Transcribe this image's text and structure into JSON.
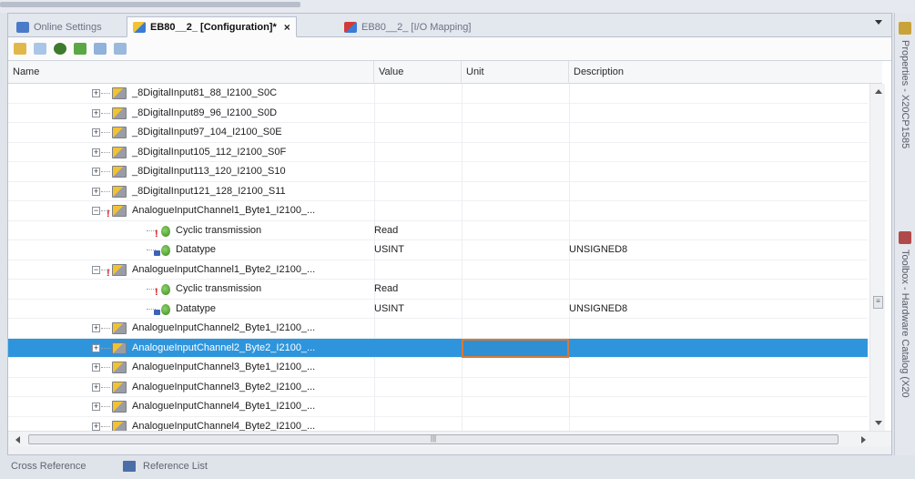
{
  "tabs": [
    {
      "label": "Online Settings",
      "icon": "online-settings-icon",
      "active": false
    },
    {
      "label": "EB80__2_ [Configuration]*",
      "icon": "configuration-icon",
      "active": true
    },
    {
      "label": "EB80__2_ [I/O Mapping]",
      "icon": "io-mapping-icon",
      "active": false
    }
  ],
  "close_symbol": "×",
  "columns": {
    "name": "Name",
    "value": "Value",
    "unit": "Unit",
    "description": "Description"
  },
  "rows": [
    {
      "name": "_8DigitalInput81_88_I2100_S0C",
      "value": "",
      "unit": "",
      "description": ""
    },
    {
      "name": "_8DigitalInput89_96_I2100_S0D",
      "value": "",
      "unit": "",
      "description": ""
    },
    {
      "name": "_8DigitalInput97_104_I2100_S0E",
      "value": "",
      "unit": "",
      "description": ""
    },
    {
      "name": "_8DigitalInput105_112_I2100_S0F",
      "value": "",
      "unit": "",
      "description": ""
    },
    {
      "name": "_8DigitalInput113_120_I2100_S10",
      "value": "",
      "unit": "",
      "description": ""
    },
    {
      "name": "_8DigitalInput121_128_I2100_S11",
      "value": "",
      "unit": "",
      "description": ""
    },
    {
      "name": "AnalogueInputChannel1_Byte1_I2100_...",
      "value": "",
      "unit": "",
      "description": ""
    },
    {
      "name": "Cyclic transmission",
      "value": "Read",
      "unit": "",
      "description": ""
    },
    {
      "name": "Datatype",
      "value": "USINT",
      "unit": "",
      "description": "UNSIGNED8"
    },
    {
      "name": "AnalogueInputChannel1_Byte2_I2100_...",
      "value": "",
      "unit": "",
      "description": ""
    },
    {
      "name": "Cyclic transmission",
      "value": "Read",
      "unit": "",
      "description": ""
    },
    {
      "name": "Datatype",
      "value": "USINT",
      "unit": "",
      "description": "UNSIGNED8"
    },
    {
      "name": "AnalogueInputChannel2_Byte1_I2100_...",
      "value": "",
      "unit": "",
      "description": ""
    },
    {
      "name": "AnalogueInputChannel2_Byte2_I2100_...",
      "value": "",
      "unit": "",
      "description": "",
      "selected": true
    },
    {
      "name": "AnalogueInputChannel3_Byte1_I2100_...",
      "value": "",
      "unit": "",
      "description": ""
    },
    {
      "name": "AnalogueInputChannel3_Byte2_I2100_...",
      "value": "",
      "unit": "",
      "description": ""
    },
    {
      "name": "AnalogueInputChannel4_Byte1_I2100_...",
      "value": "",
      "unit": "",
      "description": ""
    },
    {
      "name": "AnalogueInputChannel4_Byte2_I2100_...",
      "value": "",
      "unit": "",
      "description": ""
    }
  ],
  "side_tabs": [
    {
      "label": "Properties - X20CP1585",
      "icon": "properties-icon"
    },
    {
      "label": "Toolbox - Hardware Catalog (X20",
      "icon": "toolbox-icon"
    }
  ],
  "bottom_tabs": [
    {
      "label": "Cross Reference"
    },
    {
      "label": "Reference List",
      "icon": "reference-list-icon"
    }
  ],
  "colors": {
    "selection": "#2e95dc",
    "selection_cell_border": "#d47a3a",
    "error_marker": "#cc1e1e"
  },
  "toolbar_icons": [
    "add-icon",
    "remove-icon",
    "navigate-icon",
    "connect-icon",
    "sort-down-icon",
    "sort-up-icon"
  ]
}
